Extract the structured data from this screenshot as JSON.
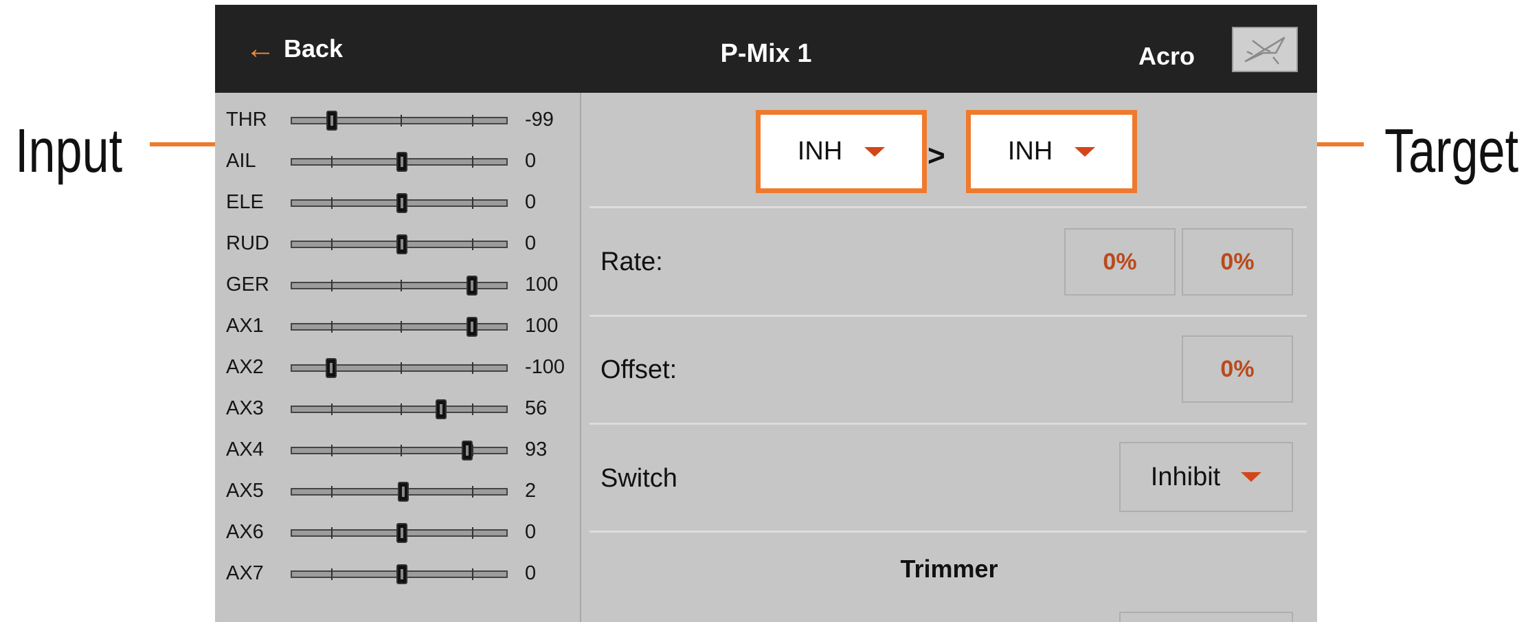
{
  "annotations": {
    "input_label": "Input",
    "target_label": "Target",
    "callout_color": "#ef7a2d"
  },
  "header": {
    "back_label": "Back",
    "title": "P-Mix 1",
    "model_type": "Acro",
    "model_icon": "airplane-icon"
  },
  "channel_monitor": [
    {
      "name": "THR",
      "value": "-99"
    },
    {
      "name": "AIL",
      "value": "0"
    },
    {
      "name": "ELE",
      "value": "0"
    },
    {
      "name": "RUD",
      "value": "0"
    },
    {
      "name": "GER",
      "value": "100"
    },
    {
      "name": "AX1",
      "value": "100"
    },
    {
      "name": "AX2",
      "value": "-100"
    },
    {
      "name": "AX3",
      "value": "56"
    },
    {
      "name": "AX4",
      "value": "93"
    },
    {
      "name": "AX5",
      "value": "2"
    },
    {
      "name": "AX6",
      "value": "0"
    },
    {
      "name": "AX7",
      "value": "0"
    }
  ],
  "mix": {
    "input": "INH",
    "separator": ">",
    "target": "INH",
    "rate_label": "Rate:",
    "rate_values": [
      "0%",
      "0%"
    ],
    "offset_label": "Offset:",
    "offset_value": "0%",
    "switch_label": "Switch",
    "switch_value": "Inhibit",
    "trimmer_label": "Trimmer"
  }
}
